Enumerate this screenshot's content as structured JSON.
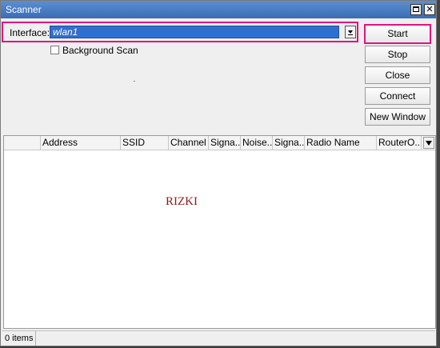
{
  "window": {
    "title": "Scanner"
  },
  "interface": {
    "label": "Interface:",
    "value": "wlan1"
  },
  "background_scan": {
    "label": "Background Scan",
    "checked": false
  },
  "buttons": {
    "start": "Start",
    "stop": "Stop",
    "close": "Close",
    "connect": "Connect",
    "new_window": "New Window"
  },
  "table": {
    "columns": [
      "",
      "Address",
      "SSID",
      "Channel",
      "Signa...",
      "Noise...",
      "Signa...",
      "Radio Name",
      "RouterO..."
    ],
    "rows": []
  },
  "watermark": "RIZKI",
  "status": {
    "items": "0 items"
  },
  "colors": {
    "highlight": "#e0147d",
    "selection": "#2f6fd1",
    "titlebar": "#3a6cb5",
    "watermark": "#8b1a1a"
  },
  "icons": {
    "maximize": "maximize-icon",
    "close": "close-icon",
    "dropdown": "dropdown-arrow-icon",
    "column_menu": "column-menu-icon"
  }
}
